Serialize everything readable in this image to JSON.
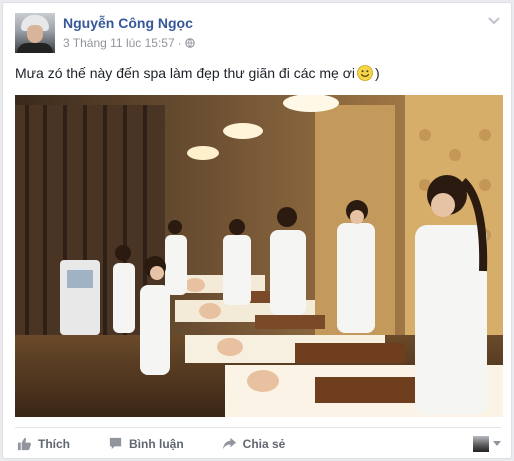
{
  "post": {
    "author": "Nguyễn Công Ngọc",
    "timestamp": "3 Tháng 11 lúc 15:57",
    "separator": "·",
    "privacy_icon": "globe-icon",
    "options_icon": "chevron-down-icon",
    "text": "Mưa zó thế này đến spa làm đẹp thư giãn đi các mẹ ơi",
    "emoji_icon": "smile-emoji-icon",
    "text_end": ")",
    "photo": "spa-treatment-room-photo"
  },
  "actions": {
    "like_label": "Thích",
    "comment_label": "Bình luận",
    "share_label": "Chia sẻ"
  },
  "colors": {
    "link": "#365899",
    "meta": "#90949c",
    "action": "#606770",
    "text": "#1d2129"
  }
}
